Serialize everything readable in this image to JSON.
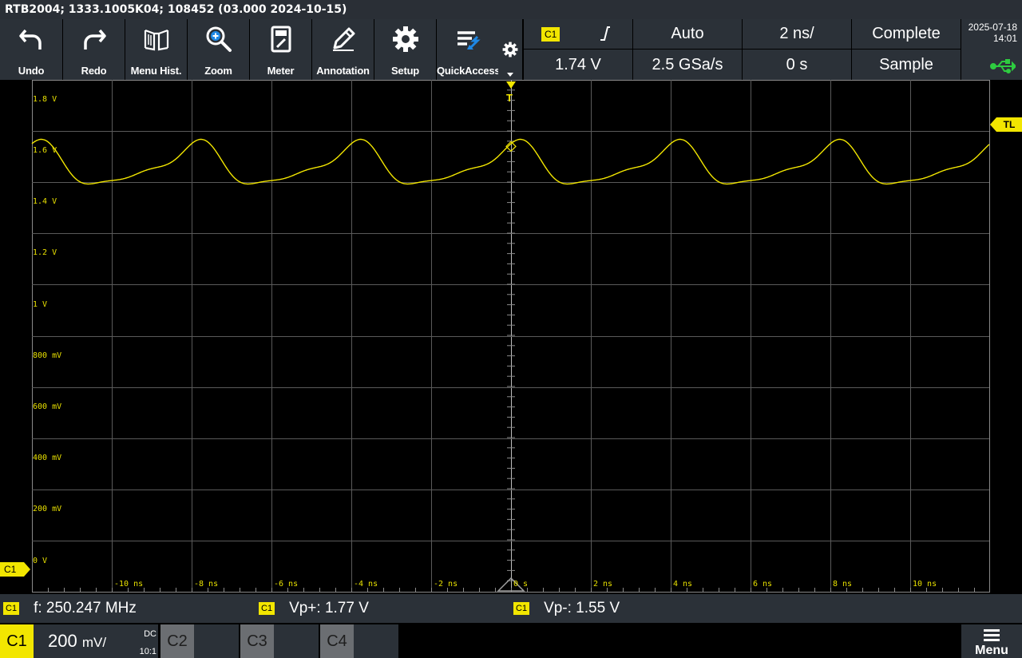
{
  "title_bar": {
    "text": "RTB2004; 1333.1005K04; 108452 (03.000 2024-10-15)"
  },
  "toolbar": {
    "buttons": [
      {
        "label": "Undo",
        "icon": "undo-icon"
      },
      {
        "label": "Redo",
        "icon": "redo-icon"
      },
      {
        "label": "Menu Hist.",
        "icon": "book-icon"
      },
      {
        "label": "Zoom",
        "icon": "zoom-icon"
      },
      {
        "label": "Meter",
        "icon": "meter-icon"
      },
      {
        "label": "Annotation",
        "icon": "pencil-icon"
      },
      {
        "label": "Setup",
        "icon": "gear-icon"
      },
      {
        "label": "QuickAccess",
        "icon": "quickaccess-icon"
      }
    ]
  },
  "status": {
    "trigger_source": "C1",
    "trigger_level": "1.74 V",
    "trigger_mode": "Auto",
    "sample_rate": "2.5 GSa/s",
    "time_scale": "2 ns/",
    "time_position": "0 s",
    "acq_state": "Complete",
    "acq_mode": "Sample",
    "date": "2025-07-18",
    "time": "14:01"
  },
  "scope": {
    "y_labels": [
      "1.8 V",
      "1.6 V",
      "1.4 V",
      "1.2 V",
      "1 V",
      "800 mV",
      "600 mV",
      "400 mV",
      "200 mV",
      "0 V"
    ],
    "x_labels": [
      "-10 ns",
      "-8 ns",
      "-6 ns",
      "-4 ns",
      "-2 ns",
      "0 s",
      "2 ns",
      "4 ns",
      "6 ns",
      "8 ns",
      "10 ns"
    ],
    "trigger_marker": "T",
    "channel_marker": "C1",
    "trigger_level_marker": "TL",
    "trace_color": "#f2e600"
  },
  "measurements": [
    {
      "source": "C1",
      "text": "f: 250.247 MHz"
    },
    {
      "source": "C1",
      "text": "Vp+: 1.77 V"
    },
    {
      "source": "C1",
      "text": "Vp-: 1.55 V"
    }
  ],
  "channels": {
    "c1": {
      "name": "C1",
      "scale": "200",
      "unit": "mV/",
      "coupling": "DC",
      "probe": "10:1"
    },
    "c2": {
      "name": "C2"
    },
    "c3": {
      "name": "C3"
    },
    "c4": {
      "name": "C4"
    }
  },
  "menu": {
    "label": "Menu"
  }
}
